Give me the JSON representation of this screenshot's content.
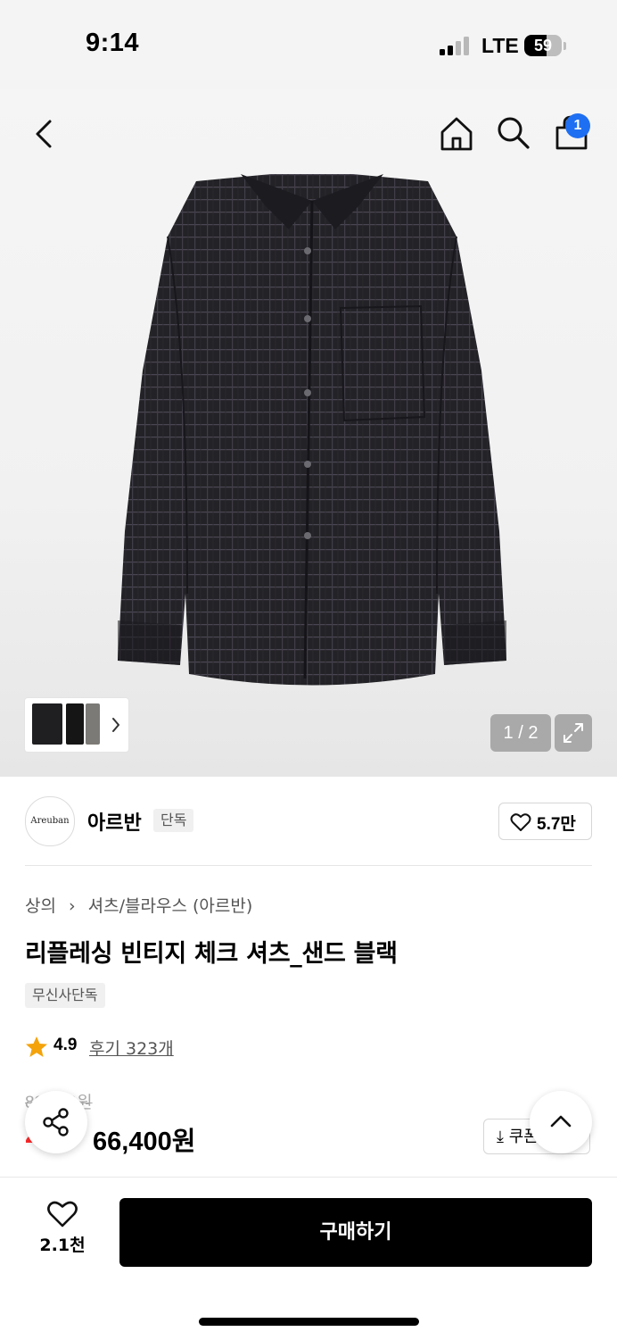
{
  "status_bar": {
    "time": "9:14",
    "network": "LTE",
    "battery": "59",
    "battery_level": 0.59
  },
  "header": {
    "back_icon": "chevron-left-icon",
    "home_icon": "home-icon",
    "search_icon": "search-icon",
    "cart_icon": "shopping-bag-icon",
    "cart_count": "1"
  },
  "gallery": {
    "pager": "1 / 2",
    "expand_icon": "expand-icon",
    "thumbnail_arrow_icon": "chevron-right-icon"
  },
  "brand": {
    "logo_text": "Areuban",
    "name": "아르반",
    "tag": "단독",
    "like_icon": "heart-icon",
    "like_count": "5.7만"
  },
  "product": {
    "breadcrumb": [
      "상의",
      "셔츠/블라우스 (아르반)"
    ],
    "title": "리플레싱 빈티지 체크 셔츠_샌드 블랙",
    "badge": "무신사단독",
    "rating": "4.9",
    "reviews": "후기 323개",
    "original_price": "83,000원",
    "discount": "20%",
    "sale_price": "66,400원",
    "coupon_label": "쿠폰"
  },
  "floating": {
    "share_icon": "share-icon",
    "top_icon": "chevron-up-icon"
  },
  "bottom_bar": {
    "wish_count": "2.1천",
    "buy_label": "구매하기"
  },
  "colors": {
    "accent_blue": "#1f6ff2",
    "discount_red": "#ff2a2a",
    "star": "#f4a30a"
  }
}
